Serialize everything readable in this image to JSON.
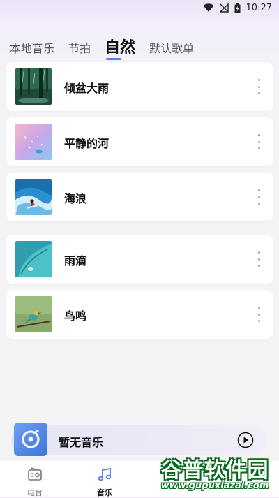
{
  "status_bar": {
    "time": "10:27",
    "icons": [
      "wifi-icon",
      "no-signal-icon",
      "battery-charging-icon"
    ]
  },
  "tabs": [
    {
      "label": "本地音乐",
      "active": false
    },
    {
      "label": "节拍",
      "active": false
    },
    {
      "label": "自然",
      "active": true
    },
    {
      "label": "默认歌单",
      "active": false
    }
  ],
  "tracks": [
    {
      "title": "倾盆大雨",
      "thumb": "forest-rain-thumbnail"
    },
    {
      "title": "平静的河",
      "thumb": "pastel-water-drops-thumbnail"
    },
    {
      "title": "海浪",
      "thumb": "surfer-wave-thumbnail"
    },
    {
      "title": "雨滴",
      "thumb": "teal-leaf-drop-thumbnail"
    },
    {
      "title": "鸟鸣",
      "thumb": "bird-on-branch-thumbnail"
    }
  ],
  "player": {
    "title": "暂无音乐",
    "cover_icon": "vinyl-disc-icon",
    "play_icon": "play-circle-icon"
  },
  "bottom_nav": [
    {
      "label": "电台",
      "icon": "radio-icon",
      "active": false
    },
    {
      "label": "音乐",
      "icon": "music-note-icon",
      "active": true
    }
  ],
  "watermark": {
    "main": "谷普软件园",
    "url": "www.gupuxiazai.com"
  },
  "colors": {
    "accent": "#4f7ae8",
    "watermark_green": "#0a6a1e"
  }
}
